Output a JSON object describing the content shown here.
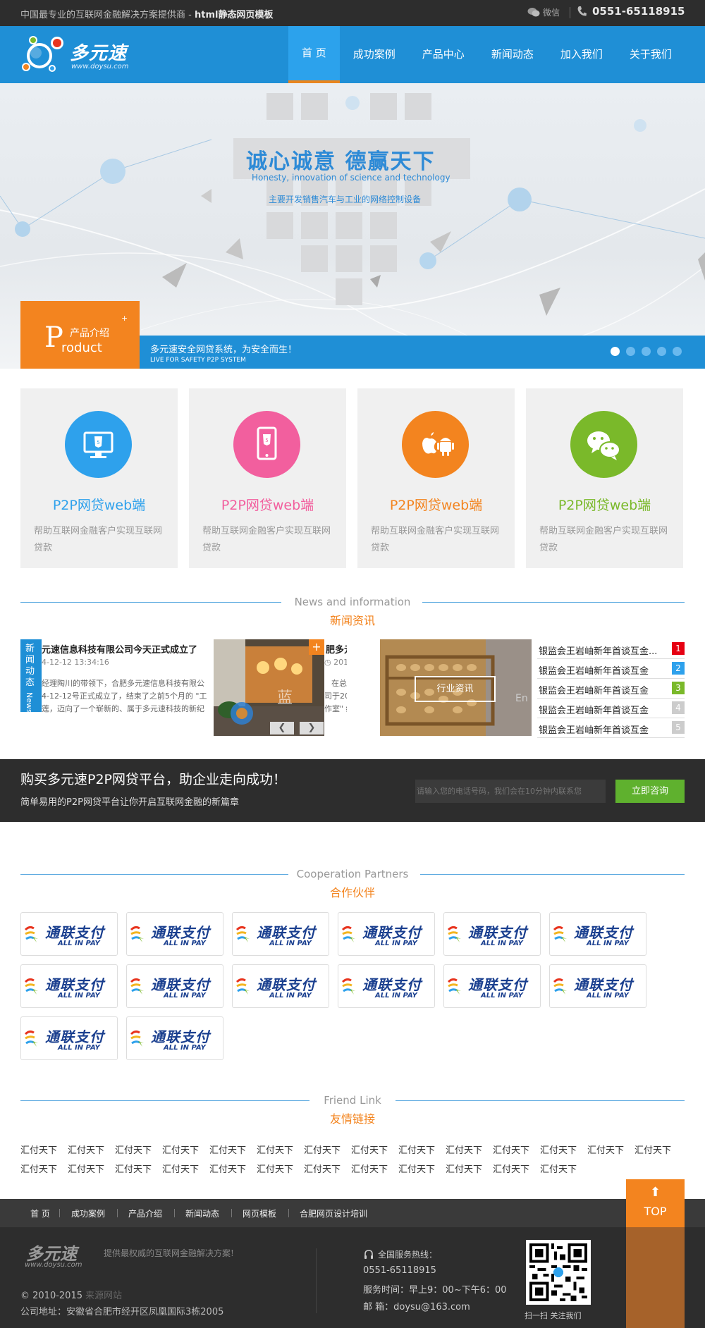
{
  "topbar": {
    "slogan_prefix": "中国最专业的互联网金融解决方案提供商 - ",
    "slogan_bold": "html静态网页模板",
    "wechat_label": "微信",
    "phone": "0551-65118915"
  },
  "header": {
    "logo_name": "多元速",
    "logo_url": "www.doysu.com",
    "nav": [
      "首 页",
      "成功案例",
      "产品中心",
      "新闻动态",
      "加入我们",
      "关于我们"
    ]
  },
  "banner": {
    "title": "诚心诚意  德赢天下",
    "subtitle_en": "Honesty, innovation of science and technology",
    "subtitle_cn": "主要开发销售汽车与工业的网络控制设备",
    "product_letter": "P",
    "product_cn": "产品介绍",
    "product_en": "roduct",
    "product_plus": "+",
    "strip_line1": "多元速安全网贷系统，为安全而生！",
    "strip_line2": "LIVE FOR SAFETY P2P SYSTEM",
    "slide_count": 5,
    "active_slide": 1
  },
  "features": [
    {
      "title": "P2P网贷web端",
      "desc": "帮助互联网金融客户实现互联网贷款",
      "color": "#2ea1ec",
      "icon": "monitor-html5-icon"
    },
    {
      "title": "P2P网贷web端",
      "desc": "帮助互联网金融客户实现互联网贷款",
      "color": "#f25f9e",
      "icon": "phone-html5-icon"
    },
    {
      "title": "P2P网贷web端",
      "desc": "帮助互联网金融客户实现互联网贷款",
      "color": "#f3841f",
      "icon": "apple-android-icon"
    },
    {
      "title": "P2P网贷web端",
      "desc": "帮助互联网金融客户实现互联网贷款",
      "color": "#7ab92a",
      "icon": "wechat-icon"
    }
  ],
  "news_section": {
    "title_en": "News and information",
    "title_cn": "新闻资讯",
    "tab_cn": "新闻动态",
    "tab_en": "News",
    "item1_title": "元速信息科技有限公司今天正式成立了",
    "item1_date": "4-12-12 13:34:16",
    "item1_text": "经理陶川的带领下，合肥多元速信息科技有限公4-12-12号正式成立了，结束了之前5个月的 \"工莲，迈向了一个崭新的、属于多元速科技的新纪",
    "item2_title": "肥多元",
    "item2_date": "2014",
    "item2_text_1": "在总",
    "item2_text_2": "司于201",
    "item2_text_3": "作室\" 结",
    "photo_plus": "+",
    "prev": "❮",
    "next": "❯",
    "industry_btn": "行业资讯",
    "industry_list": [
      {
        "title": "银监会王岩岫新年首谈互金...",
        "num": "1",
        "color": "#e60012"
      },
      {
        "title": "银监会王岩岫新年首谈互金",
        "num": "2",
        "color": "#2ea1ec"
      },
      {
        "title": "银监会王岩岫新年首谈互金",
        "num": "3",
        "color": "#7ab92a"
      },
      {
        "title": "银监会王岩岫新年首谈互金",
        "num": "4",
        "color": "#cccccc"
      },
      {
        "title": "银监会王岩岫新年首谈互金",
        "num": "5",
        "color": "#cccccc"
      }
    ]
  },
  "cta": {
    "heading": "购买多元速P2P网贷平台，助企业走向成功！",
    "sub": "简单易用的P2P网贷平台让你开启互联网金融的新篇章",
    "placeholder": "请输入您的电话号码，我们会在10分钟内联系您",
    "button": "立即咨询"
  },
  "partners": {
    "title_en": "Cooperation Partners",
    "title_cn": "合作伙伴",
    "logo_cn": "通联支付",
    "logo_en": "ALL IN PAY",
    "count": 14
  },
  "friend_links": {
    "title_en": "Friend Link",
    "title_cn": "友情链接",
    "links": [
      "汇付天下",
      "汇付天下",
      "汇付天下",
      "汇付天下",
      "汇付天下",
      "汇付天下",
      "汇付天下",
      "汇付天下",
      "汇付天下",
      "汇付天下",
      "汇付天下",
      "汇付天下",
      "汇付天下",
      "汇付天下",
      "汇付天下",
      "汇付天下",
      "汇付天下",
      "汇付天下",
      "汇付天下",
      "汇付天下",
      "汇付天下",
      "汇付天下",
      "汇付天下",
      "汇付天下",
      "汇付天下",
      "汇付天下"
    ]
  },
  "top_button": {
    "arrow": "⬆",
    "label": "TOP"
  },
  "footer": {
    "nav": [
      "首 页",
      "成功案例",
      "产品介绍",
      "新闻动态",
      "网页模板",
      "合肥网页设计培训"
    ],
    "logo_name": "多元速",
    "logo_url": "www.doysu.com",
    "motto": "提供最权威的互联网金融解决方案!",
    "copyright": "© 2010-2015 ",
    "copyright_dim": "来源网站",
    "address": "公司地址：安徽省合肥市经开区凤凰国际3栋2005",
    "hotline_label": "全国服务热线：",
    "hotline": "0551-65118915",
    "hours": "服务时间：早上9：00~下午6：00",
    "email": "邮 箱：doysu@163.com",
    "qr_caption": "扫一扫 关注我们"
  }
}
